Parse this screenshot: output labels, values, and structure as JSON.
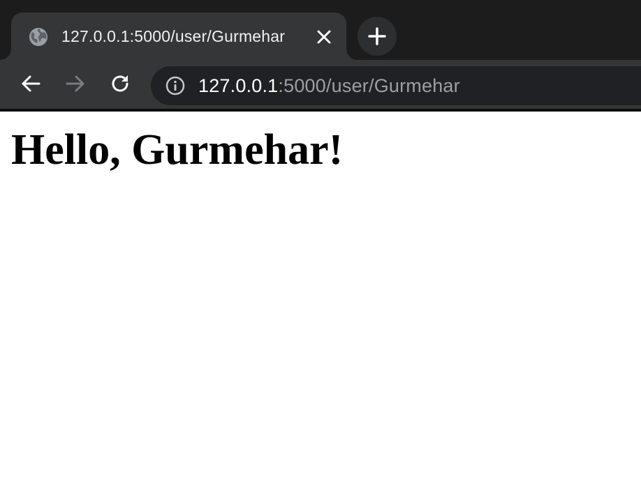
{
  "tab": {
    "title": "127.0.0.1:5000/user/Gurmehar",
    "favicon": "globe-icon",
    "close": "close-icon"
  },
  "new_tab": {
    "icon": "plus-icon"
  },
  "toolbar": {
    "back_icon": "back-arrow-icon",
    "forward_icon": "forward-arrow-icon",
    "reload_icon": "reload-icon",
    "site_info_icon": "info-icon"
  },
  "address_bar": {
    "host": "127.0.0.1",
    "rest": ":5000/user/Gurmehar"
  },
  "page": {
    "heading": "Hello, Gurmehar!"
  },
  "colors": {
    "tab_strip": "#1c1c1d",
    "toolbar": "#353638",
    "omnibox": "#202124",
    "url_dim": "#9aa0a6",
    "page_background": "#ffffff"
  }
}
